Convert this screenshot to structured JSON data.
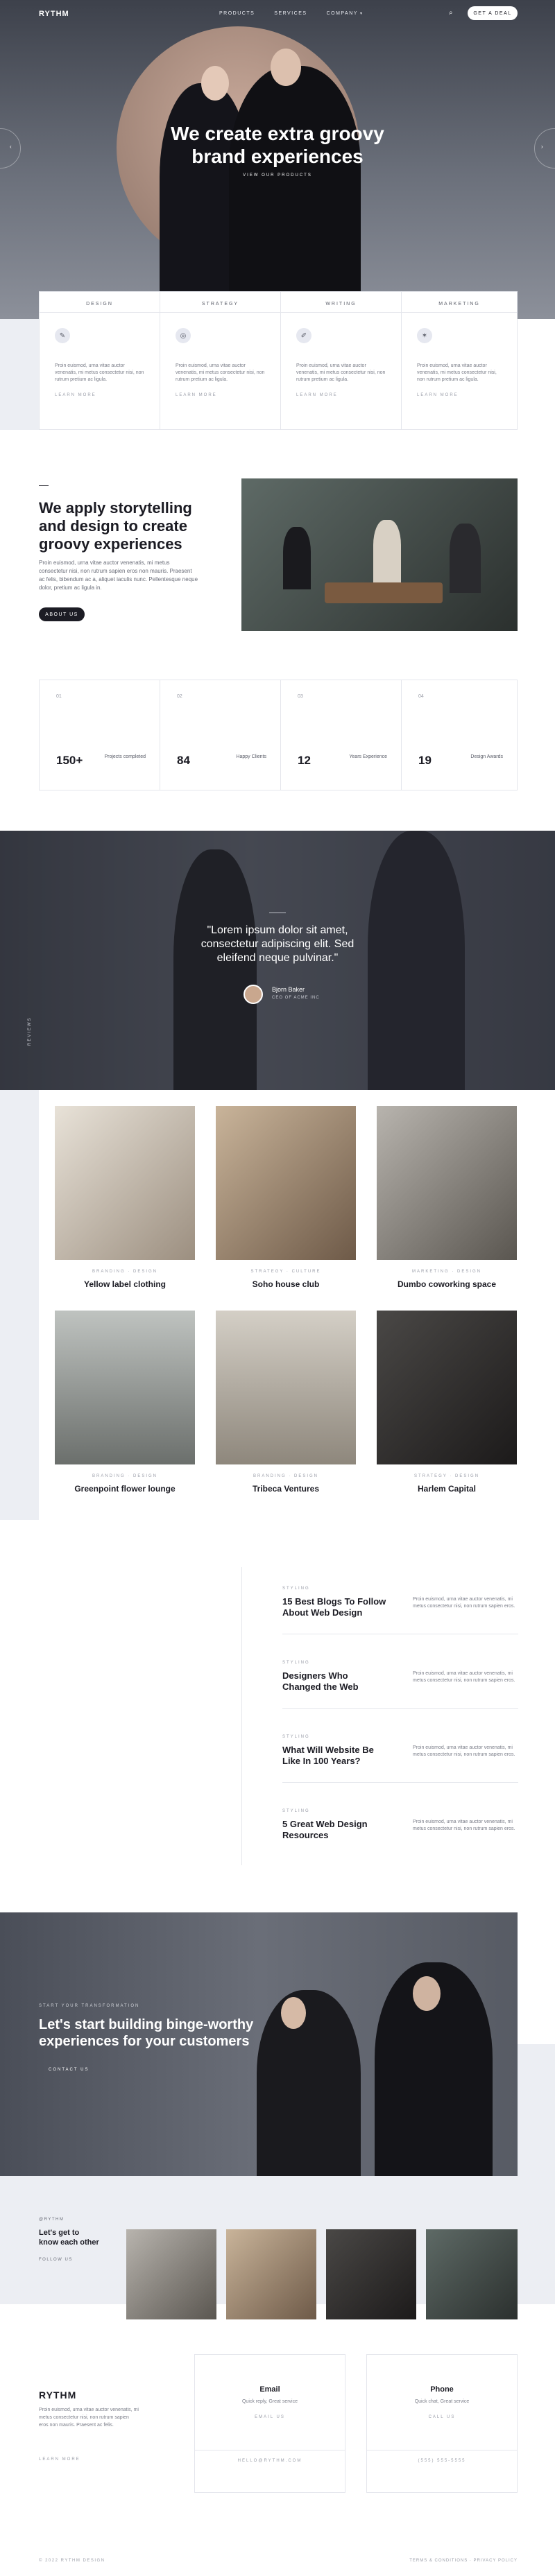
{
  "header": {
    "logo": "RYTHM",
    "nav": [
      "PRODUCTS",
      "SERVICES",
      "COMPANY"
    ],
    "cta": "GET A DEAL"
  },
  "hero": {
    "title_line1": "We create extra groovy",
    "title_line2": "brand experiences",
    "button": "VIEW OUR PRODUCTS"
  },
  "services": [
    {
      "title": "DESIGN",
      "icon": "pen-icon",
      "text": "Proin euismod, urna vitae auctor venenatis, mi metus consectetur nisi, non rutrum pretium ac ligula.",
      "link": "LEARN MORE"
    },
    {
      "title": "STRATEGY",
      "icon": "target-icon",
      "text": "Proin euismod, urna vitae auctor venenatis, mi metus consectetur nisi, non rutrum pretium ac ligula.",
      "link": "LEARN MORE"
    },
    {
      "title": "WRITING",
      "icon": "pencil-icon",
      "text": "Proin euismod, urna vitae auctor venenatis, mi metus consectetur nisi, non rutrum pretium ac ligula.",
      "link": "LEARN MORE"
    },
    {
      "title": "MARKETING",
      "icon": "megaphone-icon",
      "text": "Proin euismod, urna vitae auctor venenatis, mi metus consectetur nisi, non rutrum pretium ac ligula.",
      "link": "LEARN MORE"
    }
  ],
  "about": {
    "title_line1": "We apply storytelling",
    "title_line2": "and design to create",
    "title_line3": "groovy experiences",
    "text": "Proin euismod, urna vitae auctor venenatis, mi metus consectetur nisi, non rutrum sapien eros non mauris. Praesent ac felis, bibendum ac a, aliquet iaculis nunc. Pellentesque neque dolor, pretium ac ligula in.",
    "button": "ABOUT US"
  },
  "stats": [
    {
      "key": "01",
      "number": "150+",
      "label": "Projects completed"
    },
    {
      "key": "02",
      "number": "84",
      "label": "Happy Clients"
    },
    {
      "key": "03",
      "number": "12",
      "label": "Years Experience"
    },
    {
      "key": "04",
      "number": "19",
      "label": "Design Awards"
    }
  ],
  "testimonial": {
    "quote_line1": "\"Lorem ipsum dolor sit amet,",
    "quote_line2": "consectetur adipiscing elit. Sed",
    "quote_line3": "eleifend neque pulvinar.\"",
    "name": "Bjorn Baker",
    "role": "CEO OF ACME INC",
    "side_label": "REVIEWS"
  },
  "projects": [
    {
      "cat": "BRANDING · DESIGN",
      "title": "Yellow label clothing"
    },
    {
      "cat": "STRATEGY · CULTURE",
      "title": "Soho house club"
    },
    {
      "cat": "MARKETING · DESIGN",
      "title": "Dumbo coworking space"
    },
    {
      "cat": "BRANDING · DESIGN",
      "title": "Greenpoint flower lounge"
    },
    {
      "cat": "BRANDING · DESIGN",
      "title": "Tribeca Ventures"
    },
    {
      "cat": "STRATEGY · DESIGN",
      "title": "Harlem Capital"
    }
  ],
  "blog": [
    {
      "cat": "STYLING",
      "title": "15 Best Blogs To Follow About Web Design",
      "text": "Proin euismod, urna vitae auctor venenatis, mi metus consectetur nisi, non rutrum sapien eros."
    },
    {
      "cat": "STYLING",
      "title": "Designers Who Changed the Web",
      "text": "Proin euismod, urna vitae auctor venenatis, mi metus consectetur nisi, non rutrum sapien eros."
    },
    {
      "cat": "STYLING",
      "title": "What Will Website Be Like In 100 Years?",
      "text": "Proin euismod, urna vitae auctor venenatis, mi metus consectetur nisi, non rutrum sapien eros."
    },
    {
      "cat": "STYLING",
      "title": "5 Great Web Design Resources",
      "text": "Proin euismod, urna vitae auctor venenatis, mi metus consectetur nisi, non rutrum sapien eros."
    }
  ],
  "cta_banner": {
    "eyebrow": "START YOUR TRANSFORMATION",
    "title_line1": "Let's start building binge-worthy",
    "title_line2": "experiences for your customers",
    "button": "CONTACT US"
  },
  "instagram": {
    "handle": "@RYTHM",
    "title_line1": "Let's get to",
    "title_line2": "know each other",
    "link": "FOLLOW US"
  },
  "footer": {
    "logo": "RYTHM",
    "text": "Proin euismod, urna vitae auctor venenatis, mi metus consectetur nisi, non rutrum sapien eros non mauris. Praesent ac felis.",
    "link": "LEARN MORE",
    "email_card": {
      "title": "Email",
      "sub": "Quick reply, Great service",
      "button": "EMAIL US",
      "value": "HELLO@RYTHM.COM"
    },
    "phone_card": {
      "title": "Phone",
      "sub": "Quick chat, Great service",
      "button": "CALL US",
      "value": "(555) 555-5555"
    },
    "copyright": "© 2022 RYTHM DESIGN",
    "legal": "TERMS & CONDITIONS · PRIVACY POLICY"
  },
  "colors": {
    "dark": "#1c1c24",
    "hero": "#5a5f6a",
    "light_panel": "#eceef3"
  }
}
